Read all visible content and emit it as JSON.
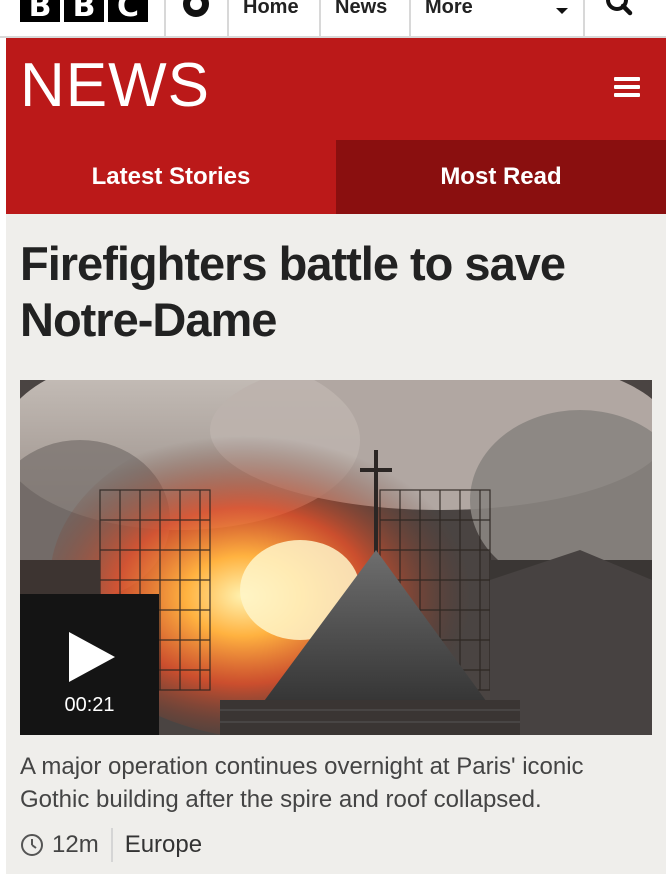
{
  "brand": {
    "bbc_letters": [
      "B",
      "B",
      "C"
    ]
  },
  "nav": {
    "links": [
      "Home",
      "News",
      "More"
    ]
  },
  "header": {
    "title": "NEWS"
  },
  "tabs": [
    {
      "label": "Latest Stories"
    },
    {
      "label": "Most Read"
    }
  ],
  "article": {
    "headline": "Firefighters battle to save Notre-Dame",
    "video_duration": "00:21",
    "summary": "A major operation continues overnight at Paris' iconic Gothic building after the spire and roof collapsed.",
    "time_ago": "12m",
    "section": "Europe"
  },
  "colors": {
    "brand_red": "#bb1919",
    "tab_selected_dark": "#8a0f0f",
    "content_bg": "#efeeeb"
  }
}
